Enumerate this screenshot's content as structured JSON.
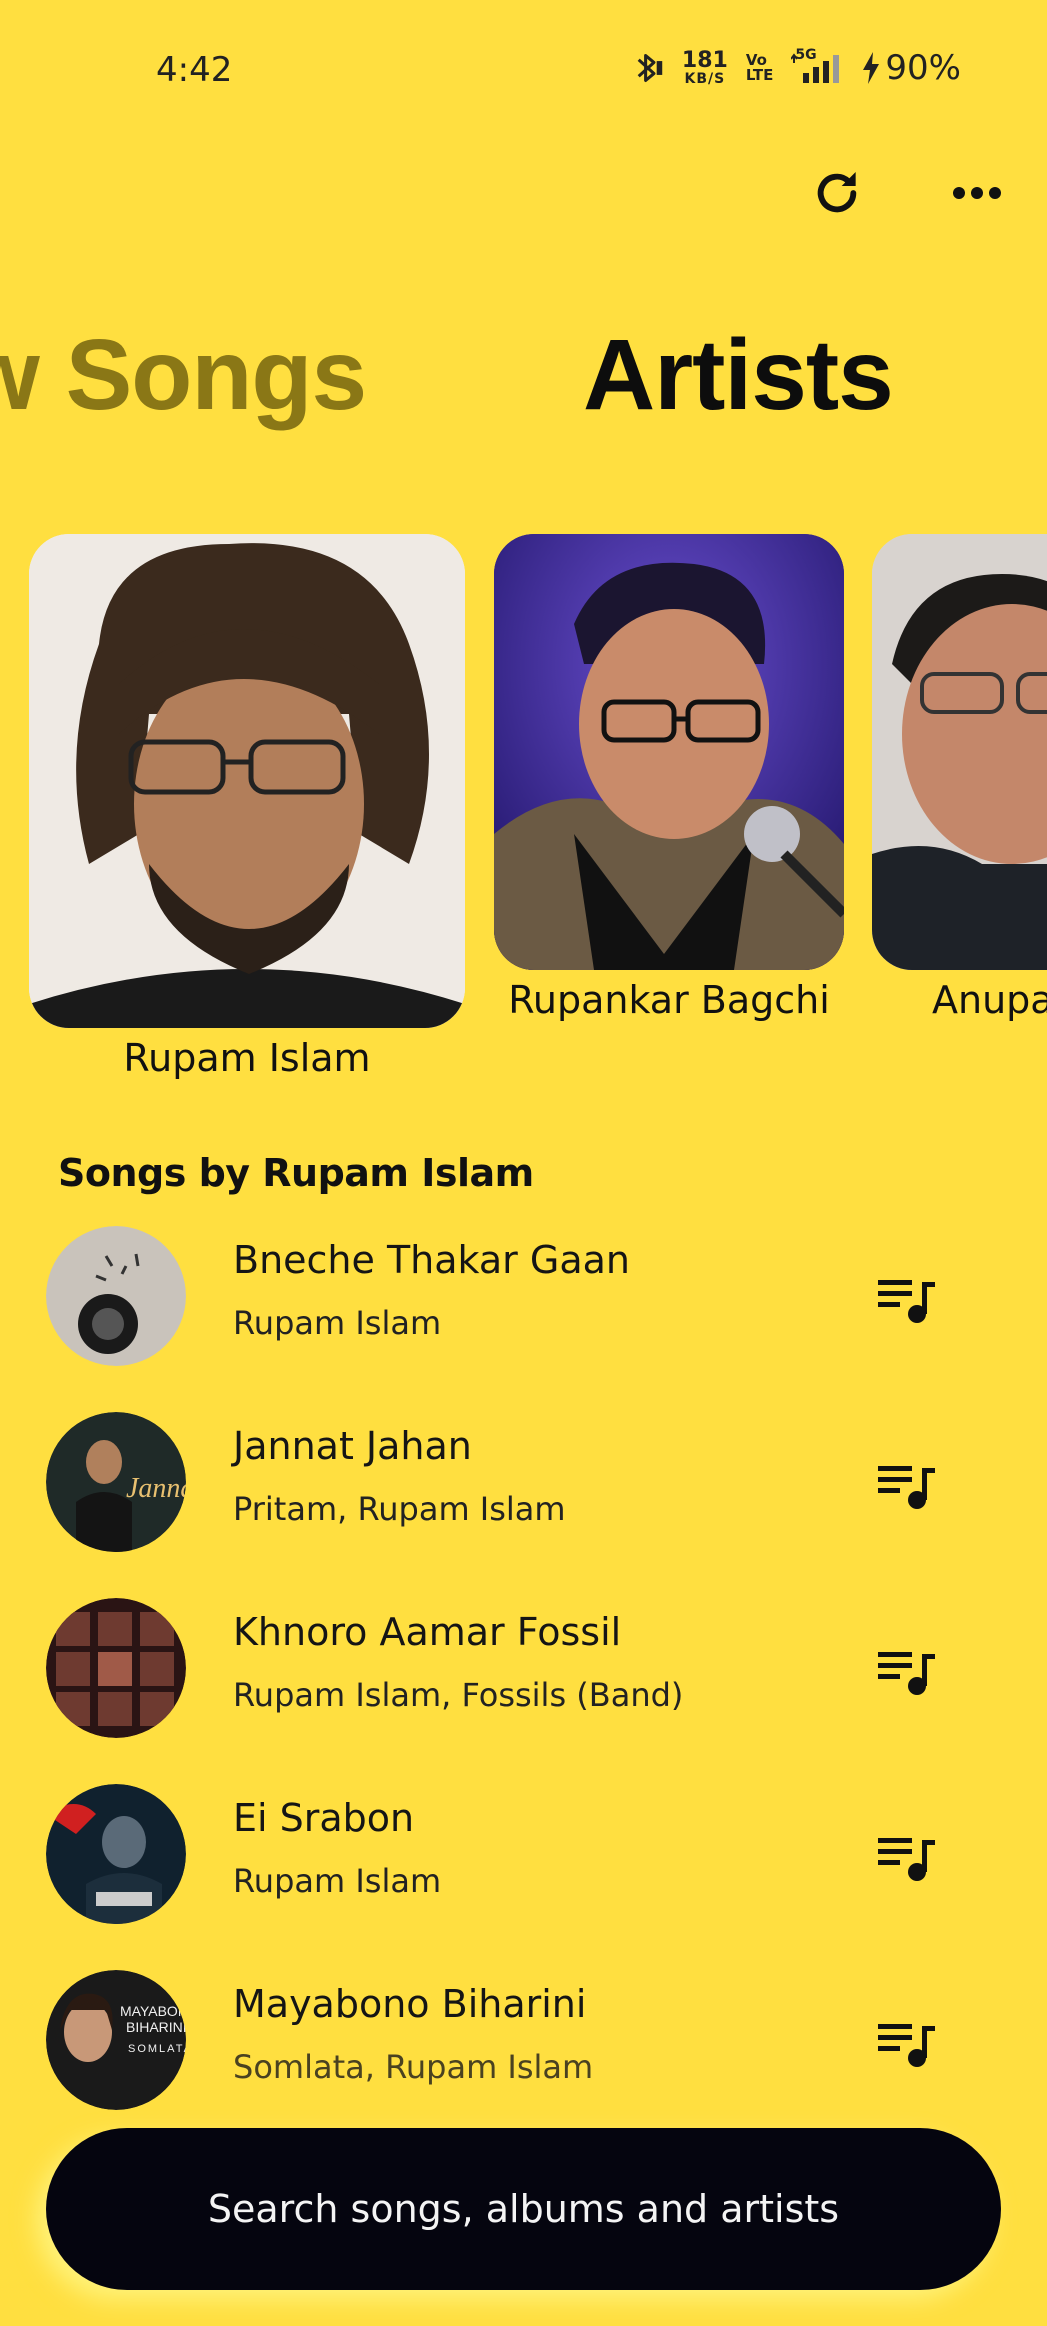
{
  "status_bar": {
    "time": "4:42",
    "net_speed": "181",
    "net_unit": "KB/S",
    "volte_top": "Vo",
    "volte_bottom": "LTE",
    "network": "5G",
    "battery": "90%"
  },
  "tabs": [
    {
      "label": "w Songs"
    },
    {
      "label": "Artists"
    }
  ],
  "artists": [
    {
      "name": "Rupam Islam"
    },
    {
      "name": "Rupankar Bagchi"
    },
    {
      "name": "Anupa"
    }
  ],
  "songs_heading": "Songs by Rupam Islam",
  "songs": [
    {
      "title": "Bneche Thakar Gaan",
      "artist": "Rupam Islam"
    },
    {
      "title": "Jannat Jahan",
      "artist": "Pritam, Rupam Islam",
      "thumb_text": "Jannat"
    },
    {
      "title": "Khnoro Aamar Fossil",
      "artist": "Rupam Islam, Fossils (Band)"
    },
    {
      "title": "Ei Srabon",
      "artist": "Rupam Islam"
    },
    {
      "title": "Mayabono Biharini",
      "artist": "Somlata, Rupam Islam",
      "thumb_text_1": "MAYABONO",
      "thumb_text_2": "BIHARINI",
      "thumb_text_3": "SOMLATA"
    }
  ],
  "search": {
    "placeholder": "Search songs, albums and artists"
  },
  "colors": {
    "background": "#FFDF40",
    "search_bar": "#05050F",
    "inactive_tab": "#8A7716"
  }
}
